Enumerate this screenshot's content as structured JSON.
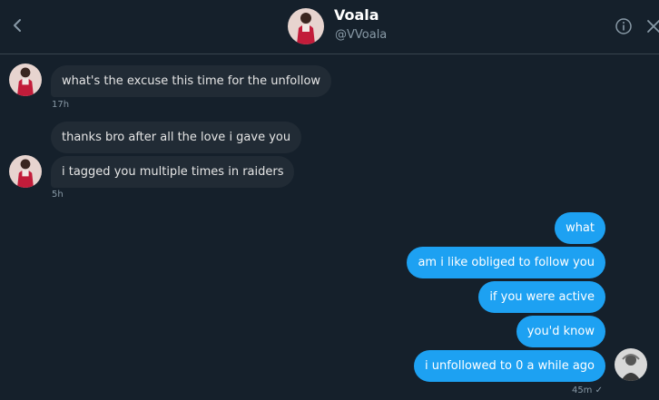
{
  "header": {
    "name": "Voala",
    "handle": "@VVoala"
  },
  "icons": {
    "back": "chevron-left-icon",
    "info": "info-icon",
    "close": "close-icon"
  },
  "colors": {
    "background": "#15202b",
    "incoming_bubble": "#212b35",
    "outgoing_bubble": "#1da1f2",
    "secondary_text": "#8899a6"
  },
  "messages_in": [
    {
      "text": "what's the excuse this time for the unfollow",
      "time": "17h"
    },
    {
      "text": "thanks bro after all the love i gave you"
    },
    {
      "text": "i tagged you multiple times in raiders",
      "time": "5h"
    }
  ],
  "messages_out": [
    {
      "text": "what"
    },
    {
      "text": "am i like obliged to follow you"
    },
    {
      "text": "if you were active"
    },
    {
      "text": "you'd know"
    },
    {
      "text": "i unfollowed to 0 a while ago",
      "time": "45m",
      "status": "✓"
    }
  ]
}
